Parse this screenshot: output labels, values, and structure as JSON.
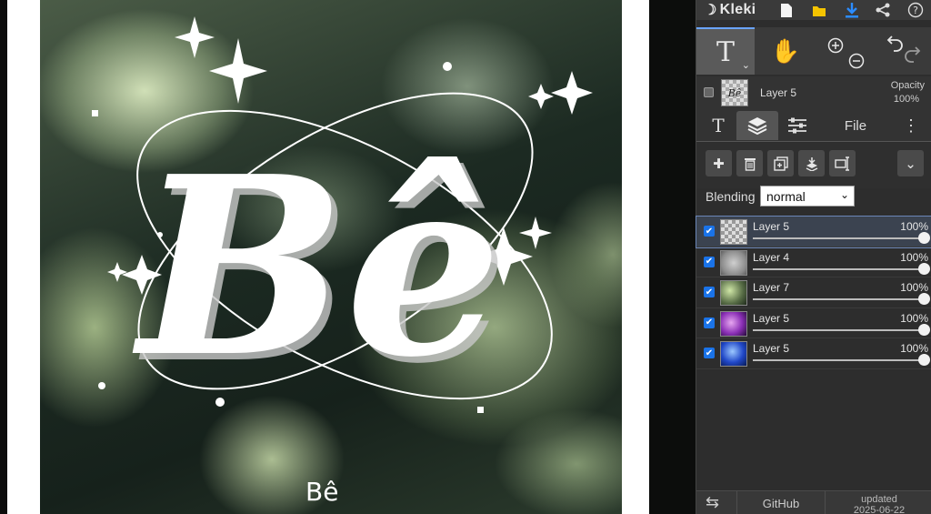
{
  "app": {
    "logo_text": "Kleki",
    "icons": [
      "new-image-icon",
      "open-folder-icon",
      "download-icon",
      "share-icon",
      "help-icon"
    ]
  },
  "artwork": {
    "title_text": "Bê",
    "caption_text": "Bê",
    "star_color": "#ffffff"
  },
  "tools": {
    "text_tool": "T",
    "hand_tool": "hand",
    "zoom_in": "zoom-in",
    "zoom_out": "zoom-out",
    "undo": "undo",
    "redo": "redo",
    "accent_color": "#6aa4ff"
  },
  "active_layer": {
    "name": "Layer 5",
    "opacity_label": "Opacity",
    "opacity_value": "100%",
    "thumb_text": "Bê"
  },
  "tabs": {
    "text_label": "T",
    "file_label": "File"
  },
  "blending": {
    "label": "Blending",
    "value": "normal"
  },
  "layers": [
    {
      "name": "Layer 5",
      "opacity": "100%",
      "opacity_fraction": 1.0,
      "checked": true,
      "selected": true,
      "thumb": "text-layer"
    },
    {
      "name": "Layer 4",
      "opacity": "100%",
      "opacity_fraction": 1.0,
      "checked": true,
      "selected": false,
      "thumb": "gray-texture"
    },
    {
      "name": "Layer 7",
      "opacity": "100%",
      "opacity_fraction": 1.0,
      "checked": true,
      "selected": false,
      "thumb": "green-jellyfish"
    },
    {
      "name": "Layer 5",
      "opacity": "100%",
      "opacity_fraction": 1.0,
      "checked": true,
      "selected": false,
      "thumb": "purple-jellyfish"
    },
    {
      "name": "Layer 5",
      "opacity": "100%",
      "opacity_fraction": 1.0,
      "checked": true,
      "selected": false,
      "thumb": "blue-jellyfish"
    }
  ],
  "footer": {
    "github_label": "GitHub",
    "updated_label": "updated",
    "updated_date": "2025-06-22"
  }
}
